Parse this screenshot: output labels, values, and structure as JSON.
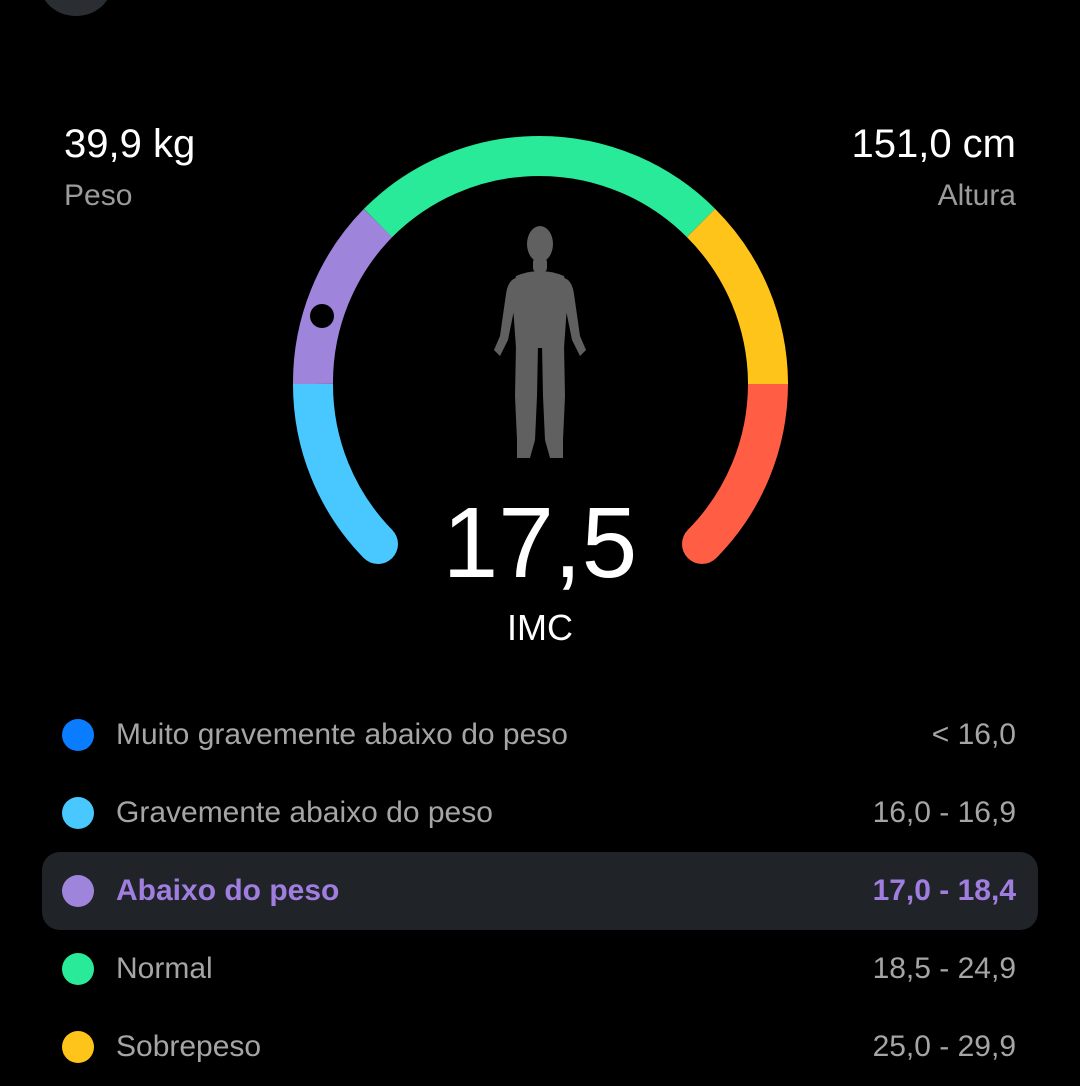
{
  "header": {
    "back_icon": "back-button"
  },
  "stats": {
    "weight": {
      "value": "39,9 kg",
      "label": "Peso"
    },
    "height": {
      "value": "151,0 cm",
      "label": "Altura"
    }
  },
  "gauge": {
    "bmi_value": "17,5",
    "bmi_label": "IMC",
    "body_icon": "human-body-icon",
    "segments": [
      {
        "name": "muito-gravemente-abaixo",
        "color": "#48c8ff"
      },
      {
        "name": "abaixo",
        "color": "#9f84dc"
      },
      {
        "name": "normal",
        "color": "#29ea98"
      },
      {
        "name": "sobrepeso",
        "color": "#ffc419"
      },
      {
        "name": "obesidade",
        "color": "#ff5e45"
      }
    ]
  },
  "legend": [
    {
      "label": "Muito gravemente abaixo do peso",
      "range": "< 16,0",
      "color": "#0a7cff",
      "selected": false
    },
    {
      "label": "Gravemente abaixo do peso",
      "range": "16,0 - 16,9",
      "color": "#48c8ff",
      "selected": false
    },
    {
      "label": "Abaixo do peso",
      "range": "17,0 - 18,4",
      "color": "#9f84dc",
      "selected": true
    },
    {
      "label": "Normal",
      "range": "18,5 - 24,9",
      "color": "#29ea98",
      "selected": false
    },
    {
      "label": "Sobrepeso",
      "range": "25,0 - 29,9",
      "color": "#ffc419",
      "selected": false
    }
  ]
}
